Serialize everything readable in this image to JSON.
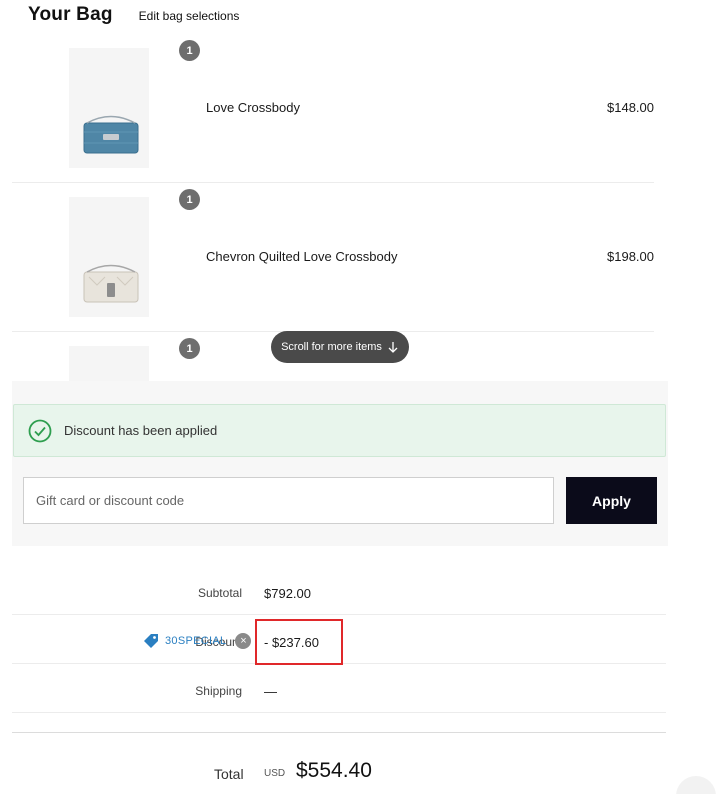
{
  "header": {
    "title": "Your Bag",
    "edit_link": "Edit bag selections"
  },
  "items": [
    {
      "qty": "1",
      "name": "Love Crossbody",
      "price": "$148.00",
      "image": "blue-crossbody-bag"
    },
    {
      "qty": "1",
      "name": "Chevron Quilted Love Crossbody",
      "price": "$198.00",
      "image": "cream-quilted-crossbody-bag"
    },
    {
      "qty": "1",
      "name": "",
      "price": "",
      "image": ""
    }
  ],
  "scroll_hint": {
    "label": "Scroll for more items",
    "icon": "arrow-down-icon"
  },
  "promo": {
    "alert_text": "Discount has been applied",
    "alert_icon": "check-circle-icon",
    "input_placeholder": "Gift card or discount code",
    "input_value": "",
    "apply_label": "Apply"
  },
  "summary": {
    "subtotal_label": "Subtotal",
    "subtotal_value": "$792.00",
    "discount_label": "Discount",
    "discount_code": "30SPECIAL",
    "discount_value": "- $237.60",
    "shipping_label": "Shipping",
    "shipping_value": "—"
  },
  "total": {
    "label": "Total",
    "currency": "USD",
    "amount": "$554.40"
  },
  "colors": {
    "accent_dark": "#0b0b1a",
    "success_bg": "#e8f5ec",
    "success_icon": "#2e9e4f",
    "tag_blue": "#2a7fc1",
    "highlight_red": "#e0282a"
  }
}
